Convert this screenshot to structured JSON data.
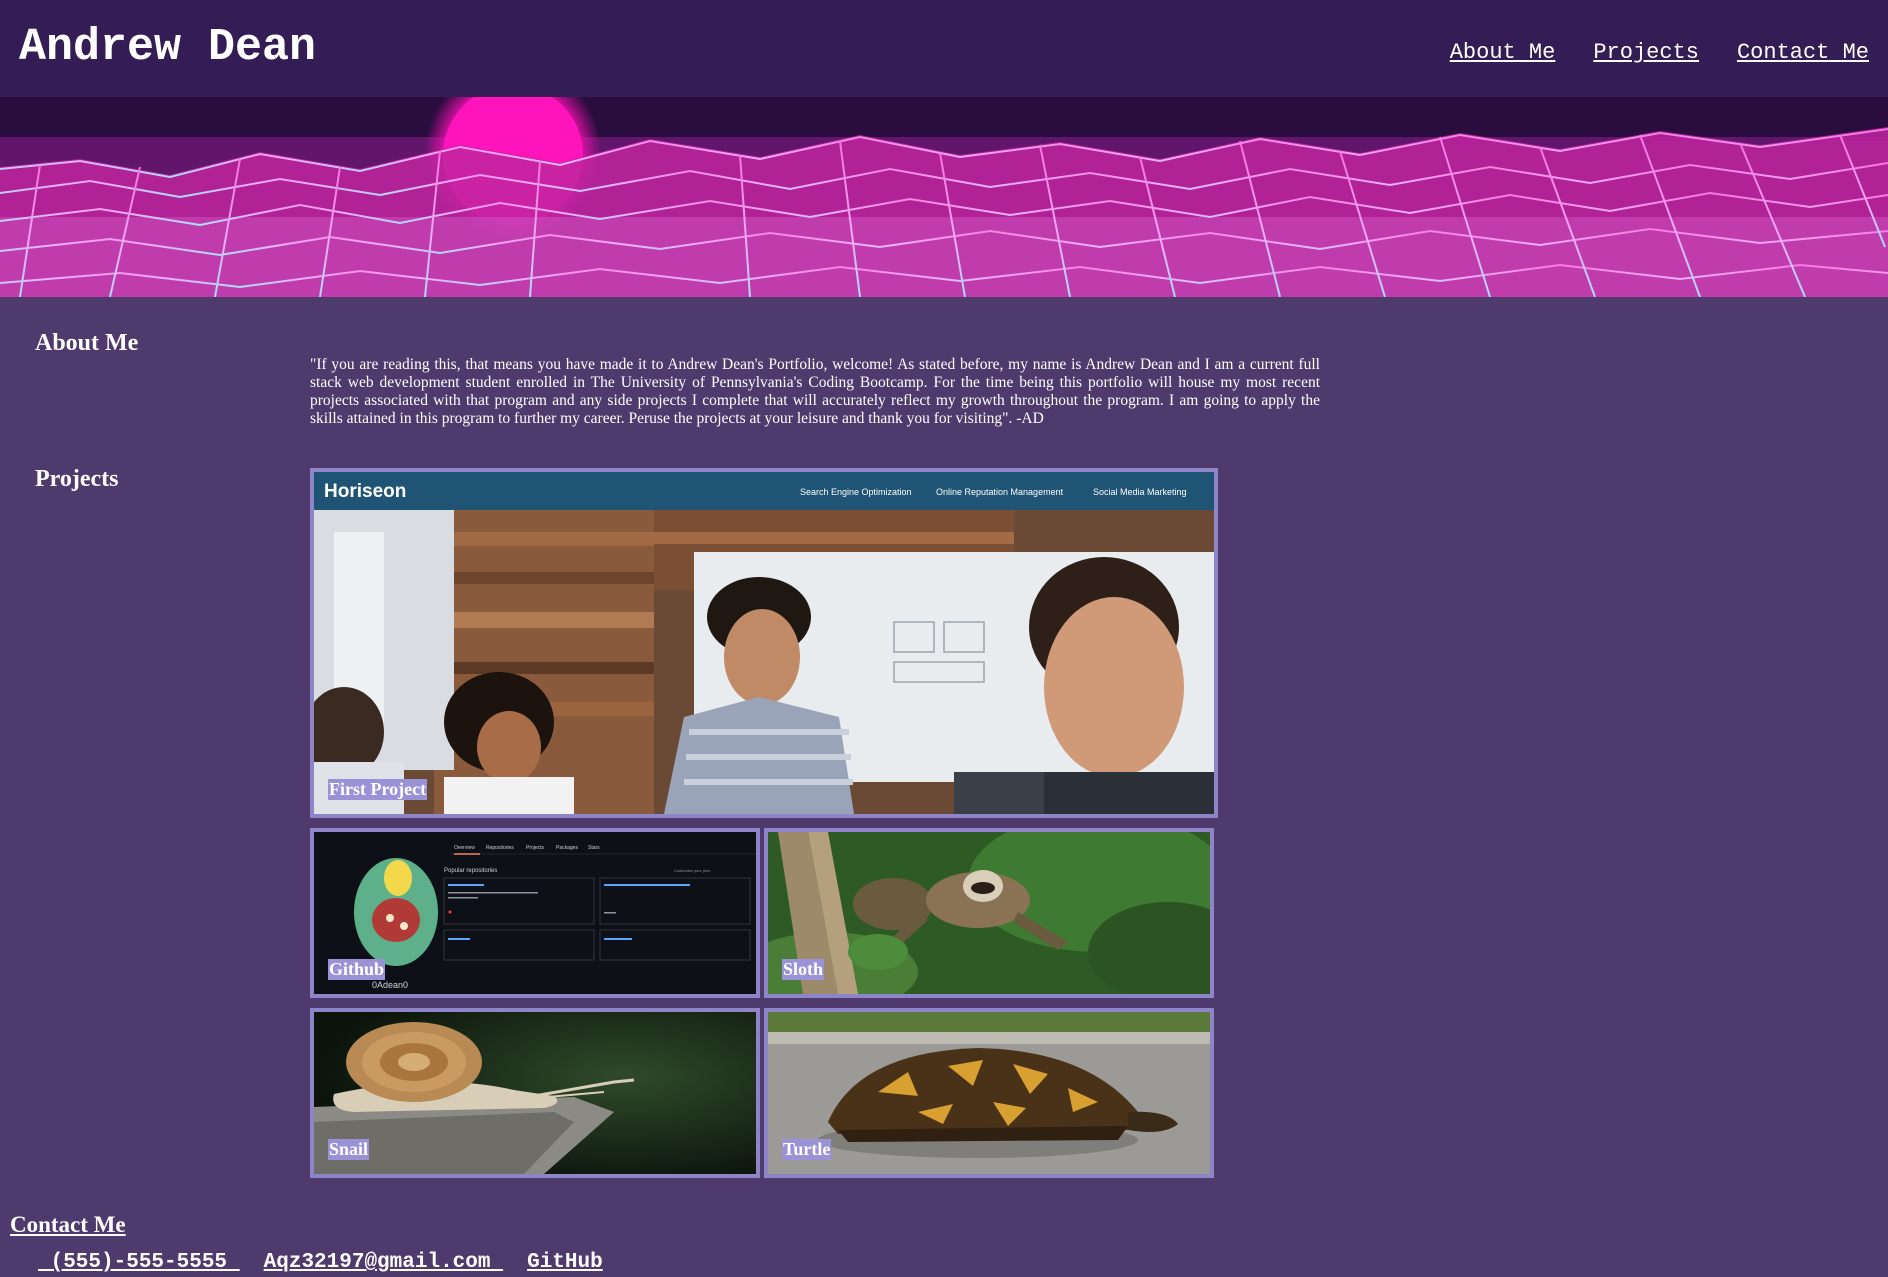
{
  "header": {
    "title": "Andrew Dean",
    "nav": [
      "About Me",
      "Projects",
      "Contact Me"
    ]
  },
  "about": {
    "heading": "About Me",
    "text": "\"If you are reading this, that means you have made it to Andrew Dean's Portfolio, welcome! As stated before, my name is Andrew Dean and I am a current full stack web development student enrolled in The University of Pennsylvania's Coding Bootcamp. For the time being this portfolio will house my most recent projects associated with that program and any side projects I complete that will accurately reflect my growth throughout the program. I am going to apply the skills attained in this program to further my career. Peruse the projects at your leisure and thank you for visiting\". -AD"
  },
  "projects": {
    "heading": "Projects",
    "items": [
      {
        "label": "First Project",
        "screenshot": {
          "brand": "Horiseon",
          "nav": [
            "Search Engine Optimization",
            "Online Reputation Management",
            "Social Media Marketing"
          ]
        }
      },
      {
        "label": "Github",
        "screenshot": {
          "username": "0Adean0",
          "tabs": [
            "Overview",
            "Repositories",
            "Projects",
            "Packages",
            "Stars"
          ],
          "section_title": "Popular repositories",
          "customize": "Customize your pins"
        }
      },
      {
        "label": "Sloth"
      },
      {
        "label": "Snail"
      },
      {
        "label": "Turtle"
      }
    ]
  },
  "contact": {
    "heading": "Contact Me",
    "links": [
      " (555)-555-5555 ",
      "Aqz32197@gmail.com ",
      "GitHub"
    ]
  },
  "colors": {
    "header_bg": "#341c54",
    "page_bg": "#4e3a6c",
    "card_border": "#8e84c8",
    "label_bg": "#9a92d6",
    "hero_sun": "#ff1fbf"
  }
}
